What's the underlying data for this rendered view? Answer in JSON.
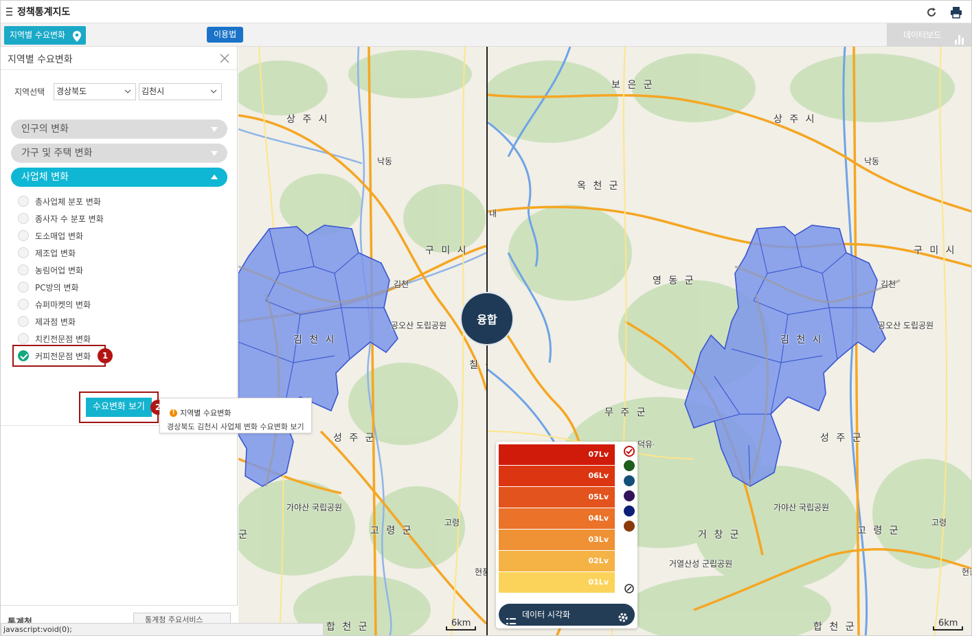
{
  "header": {
    "title": "정책통계지도"
  },
  "toolbar": {
    "region_button": "지역별 수요변화",
    "usage_button": "이용법",
    "dashboard_button": "데이터보드"
  },
  "panel": {
    "title": "지역별 수요변화",
    "region_label": "지역선택",
    "province": "경상북도",
    "city": "김천시",
    "accordions": [
      "인구의 변화",
      "가구 및 주택 변화",
      "사업체 변화"
    ],
    "options": [
      {
        "label": "총사업체 분포 변화",
        "checked": false
      },
      {
        "label": "종사자 수 분포 변화",
        "checked": false
      },
      {
        "label": "도소매업 변화",
        "checked": false
      },
      {
        "label": "제조업 변화",
        "checked": false
      },
      {
        "label": "농림어업 변화",
        "checked": false
      },
      {
        "label": "PC방의 변화",
        "checked": false
      },
      {
        "label": "슈퍼마켓의 변화",
        "checked": false
      },
      {
        "label": "제과점 변화",
        "checked": false
      },
      {
        "label": "치킨전문점 변화",
        "checked": false
      },
      {
        "label": "커피전문점 변화",
        "checked": true
      }
    ],
    "badge1": "1",
    "badge2": "2",
    "show_button": "수요변화 보기",
    "tooltip": {
      "title": "지역별 수요변화",
      "description": "경상북도 김천시 사업체 변화 수요변화 보기"
    },
    "footer_logo": "통계청",
    "footer_button": "통계청 주요서비스"
  },
  "status_bar": "javascript:void(0);",
  "fuse_button": "융합",
  "map_left": {
    "labels": [
      "상 주 시",
      "구 미 시",
      "김 천 시",
      "성 주 군",
      "고 령 군",
      "칠 곡",
      "공오산 도립공원",
      "가야산 국립공원",
      "낙동",
      "김천",
      "고령",
      "현풍",
      "합 천 군",
      "군",
      "군"
    ],
    "scale": "6km"
  },
  "map_right": {
    "labels": [
      "보 은 군",
      "상 주 시",
      "옥 천 군",
      "영 동 군",
      "구 미 시",
      "김 천 시",
      "무 주 군",
      "성 주 군",
      "거 창 군",
      "고 령 군",
      "합 천 군",
      "공오산 도립공원",
      "가야산 국립공원",
      "거열산성 군립공원",
      "덕유산 국립공원",
      "낙동",
      "김천",
      "고령",
      "현풍",
      "내"
    ],
    "scale": "6km"
  },
  "legend": {
    "levels": [
      {
        "label": "07Lv",
        "color": "#d01a0a"
      },
      {
        "label": "06Lv",
        "color": "#dc3512"
      },
      {
        "label": "05Lv",
        "color": "#e3531d"
      },
      {
        "label": "04Lv",
        "color": "#ea7229"
      },
      {
        "label": "03Lv",
        "color": "#ef9135"
      },
      {
        "label": "02Lv",
        "color": "#f5b245"
      },
      {
        "label": "01Lv",
        "color": "#fcd35a"
      }
    ],
    "swatches": [
      "#ffffff",
      "#1d5e1d",
      "#134f78",
      "#32135c",
      "#0e1f78",
      "#8a3a0a"
    ],
    "viz_button": "데이터 시각화"
  },
  "colors": {
    "accent": "#10b7d4",
    "highlight_border": "#a21212",
    "region_fill": "#7090e6"
  }
}
